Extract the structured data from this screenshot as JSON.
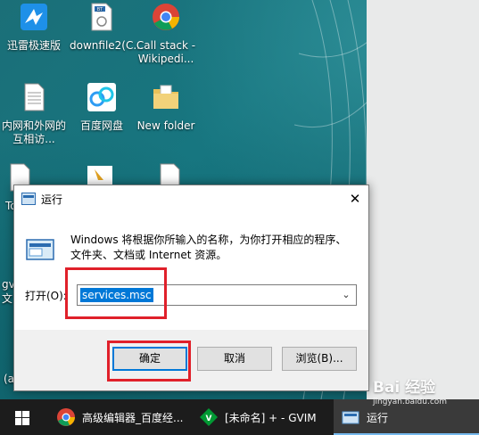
{
  "desktop": {
    "icons": [
      {
        "label": "迅雷极速版",
        "icon": "thunder-bird-icon"
      },
      {
        "label": "downfile2(C...",
        "icon": "torrent-file-icon",
        "badge": "BT"
      },
      {
        "label": "Call stack - Wikipedi...",
        "icon": "chrome-icon"
      },
      {
        "label": "内网和外网的互相访...",
        "icon": "text-document-icon"
      },
      {
        "label": "百度网盘",
        "icon": "baidu-netdisk-icon"
      },
      {
        "label": "New folder",
        "icon": "folder-icon"
      },
      {
        "label": "To",
        "icon": "text-document-icon"
      },
      {
        "label": "gv",
        "icon": "text-document-icon"
      },
      {
        "label": "文",
        "icon": "text-document-icon"
      },
      {
        "label": "(a",
        "icon": "text-document-icon"
      }
    ]
  },
  "run_dialog": {
    "title": "运行",
    "close_symbol": "✕",
    "description": "Windows 将根据你所输入的名称，为你打开相应的程序、文件夹、文档或 Internet 资源。",
    "open_label": "打开(O):",
    "open_value": "services.msc",
    "buttons": {
      "ok": "确定",
      "cancel": "取消",
      "browse": "浏览(B)..."
    }
  },
  "taskbar": {
    "items": [
      {
        "label": "高级编辑器_百度经...",
        "icon": "chrome-icon"
      },
      {
        "label": "[未命名] + - GVIM",
        "icon": "gvim-icon"
      },
      {
        "label": "运行",
        "icon": "run-icon"
      }
    ]
  },
  "watermark": {
    "text": "Bai 经验",
    "sub": "jingyan.baidu.com"
  },
  "colors": {
    "accent": "#0078d7",
    "highlight": "#e0202a",
    "taskbar": "#1c1c1c"
  }
}
